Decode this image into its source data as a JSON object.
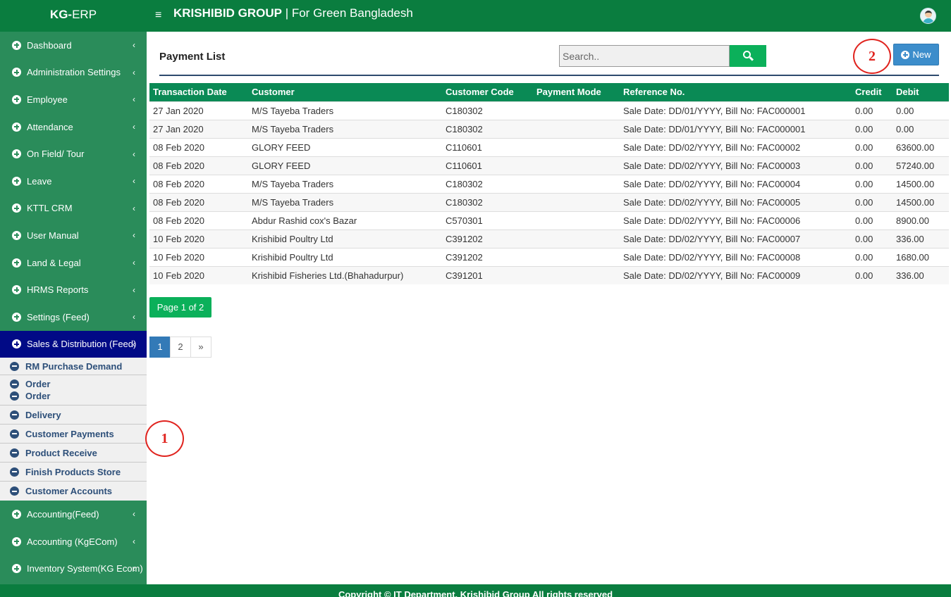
{
  "app": {
    "brand_bold": "KG-",
    "brand_rest": "ERP"
  },
  "header": {
    "company": "KRISHIBID GROUP",
    "tagline": "| For Green Bangladesh",
    "menu_glyph": "≡"
  },
  "sidebar": {
    "items_top": [
      {
        "label": "Dashboard"
      },
      {
        "label": "Administration Settings"
      },
      {
        "label": "Employee"
      },
      {
        "label": "Attendance"
      },
      {
        "label": "On Field/ Tour"
      },
      {
        "label": "Leave"
      },
      {
        "label": "KTTL CRM"
      },
      {
        "label": "User Manual"
      },
      {
        "label": "Land & Legal"
      },
      {
        "label": "HRMS Reports"
      },
      {
        "label": "Settings (Feed)"
      }
    ],
    "active": {
      "label": "Sales & Distribution (Feed)"
    },
    "submenu": [
      {
        "label": "RM Purchase Demand"
      },
      {
        "label": "Order"
      },
      {
        "label": "Order"
      },
      {
        "label": "Delivery"
      },
      {
        "label": "Customer Payments"
      },
      {
        "label": "Product Receive"
      },
      {
        "label": "Finish Products Store"
      },
      {
        "label": "Customer Accounts"
      }
    ],
    "items_bottom": [
      {
        "label": "Accounting(Feed)"
      },
      {
        "label": "Accounting (KgECom)"
      },
      {
        "label": "Inventory System(KG Ecom)"
      }
    ],
    "chevron": "‹"
  },
  "main": {
    "title": "Payment List",
    "search_placeholder": "Search..",
    "new_label": "New",
    "annotations": [
      "1",
      "2"
    ],
    "table": {
      "headers": [
        "Transaction Date",
        "Customer",
        "Customer Code",
        "Payment Mode",
        "Reference No.",
        "Credit",
        "Debit"
      ],
      "rows": [
        [
          "27 Jan 2020",
          "M/S Tayeba Traders",
          "C180302",
          "",
          "Sale Date: DD/01/YYYY, Bill No: FAC000001",
          "0.00",
          "0.00"
        ],
        [
          "27 Jan 2020",
          "M/S Tayeba Traders",
          "C180302",
          "",
          "Sale Date: DD/01/YYYY, Bill No: FAC000001",
          "0.00",
          "0.00"
        ],
        [
          "08 Feb 2020",
          "GLORY FEED",
          "C110601",
          "",
          "Sale Date: DD/02/YYYY, Bill No: FAC00002",
          "0.00",
          "63600.00"
        ],
        [
          "08 Feb 2020",
          "GLORY FEED",
          "C110601",
          "",
          "Sale Date: DD/02/YYYY, Bill No: FAC00003",
          "0.00",
          "57240.00"
        ],
        [
          "08 Feb 2020",
          "M/S Tayeba Traders",
          "C180302",
          "",
          "Sale Date: DD/02/YYYY, Bill No: FAC00004",
          "0.00",
          "14500.00"
        ],
        [
          "08 Feb 2020",
          "M/S Tayeba Traders",
          "C180302",
          "",
          "Sale Date: DD/02/YYYY, Bill No: FAC00005",
          "0.00",
          "14500.00"
        ],
        [
          "08 Feb 2020",
          "Abdur Rashid cox's Bazar",
          "C570301",
          "",
          "Sale Date: DD/02/YYYY, Bill No: FAC00006",
          "0.00",
          "8900.00"
        ],
        [
          "10 Feb 2020",
          "Krishibid Poultry Ltd",
          "C391202",
          "",
          "Sale Date: DD/02/YYYY, Bill No: FAC00007",
          "0.00",
          "336.00"
        ],
        [
          "10 Feb 2020",
          "Krishibid Poultry Ltd",
          "C391202",
          "",
          "Sale Date: DD/02/YYYY, Bill No: FAC00008",
          "0.00",
          "1680.00"
        ],
        [
          "10 Feb 2020",
          "Krishibid Fisheries Ltd.(Bhahadurpur)",
          "C391201",
          "",
          "Sale Date: DD/02/YYYY, Bill No: FAC00009",
          "0.00",
          "336.00"
        ]
      ]
    },
    "page_badge": "Page 1 of 2",
    "pager": [
      "1",
      "2",
      "»"
    ]
  },
  "footer": {
    "text": "Copyright © IT Department, Krishibid Group All rights reserved"
  },
  "colors": {
    "header_green": "#0a7d3f",
    "sidebar_green": "#2a8c5a",
    "active_navy": "#010a86",
    "table_head": "#0a8a55",
    "button_green": "#0bb05a",
    "new_blue": "#3c8dcb",
    "annotation_red": "#e0231e"
  }
}
